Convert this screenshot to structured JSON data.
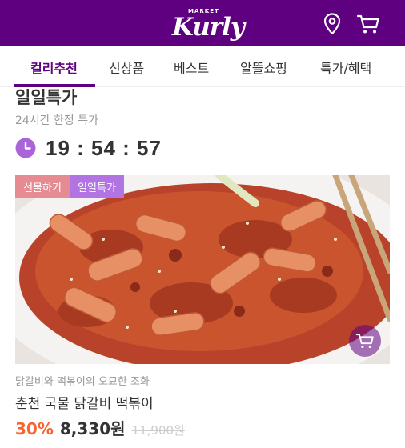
{
  "header": {
    "logo_small": "MARKET",
    "logo_main": "Kurly",
    "icons": [
      "location-pin-icon",
      "cart-icon"
    ],
    "background_color": "#5f0080"
  },
  "tabs": [
    {
      "label": "컬리추천",
      "active": true
    },
    {
      "label": "신상품",
      "active": false
    },
    {
      "label": "베스트",
      "active": false
    },
    {
      "label": "알뜰쇼핑",
      "active": false
    },
    {
      "label": "특가/혜택",
      "active": false
    }
  ],
  "section": {
    "title": "일일특가",
    "subtitle": "24시간 한정 특가",
    "timer": "19 : 54 : 57",
    "timer_icon": "clock-icon",
    "accent_color": "#a864d8"
  },
  "product": {
    "badges": [
      "선물하기",
      "일일특가"
    ],
    "description": "닭갈비와 떡볶이의 오묘한 조화",
    "name": "춘천 국물 닭갈비 떡볶이",
    "discount": "30%",
    "price": "8,330원",
    "original_price": "11,900원",
    "discount_color": "#fa622f"
  }
}
